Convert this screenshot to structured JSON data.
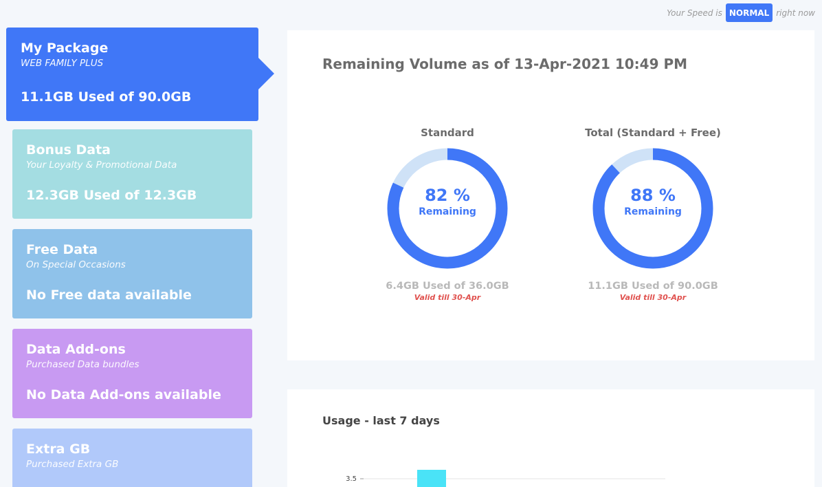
{
  "speed": {
    "prefix": "Your Speed is",
    "badge": "NORMAL",
    "suffix": "right now"
  },
  "package": {
    "title": "My Package",
    "subtitle": "WEB FAMILY PLUS",
    "usage": "11.1GB Used of 90.0GB"
  },
  "cards": {
    "bonus": {
      "title": "Bonus Data",
      "subtitle": "Your Loyalty & Promotional Data",
      "usage": "12.3GB Used of 12.3GB"
    },
    "free": {
      "title": "Free Data",
      "subtitle": "On Special Occasions",
      "usage": "No Free data available"
    },
    "addons": {
      "title": "Data Add-ons",
      "subtitle": "Purchased Data bundles",
      "usage": "No Data Add-ons available"
    },
    "extra": {
      "title": "Extra GB",
      "subtitle": "Purchased Extra GB"
    }
  },
  "volume": {
    "title": "Remaining Volume as of 13-Apr-2021 10:49 PM",
    "donuts": [
      {
        "label": "Standard",
        "percent_text": "82 %",
        "remaining_fraction": 0.82,
        "remaining_label": "Remaining",
        "used": "6.4GB Used of 36.0GB",
        "valid": "Valid till 30-Apr"
      },
      {
        "label": "Total (Standard + Free)",
        "percent_text": "88 %",
        "remaining_fraction": 0.88,
        "remaining_label": "Remaining",
        "used": "11.1GB Used of 90.0GB",
        "valid": "Valid till 30-Apr"
      }
    ]
  },
  "usage": {
    "title": "Usage - last 7 days",
    "chart_data": {
      "type": "bar",
      "y_tick_labels": [
        "3.5"
      ],
      "visible_bar_top_value": 3.5
    }
  },
  "colors": {
    "accent": "#4077f7",
    "ring_light": "#cfe2f7",
    "bar": "#4ae3f7",
    "warning": "#e0524f"
  }
}
